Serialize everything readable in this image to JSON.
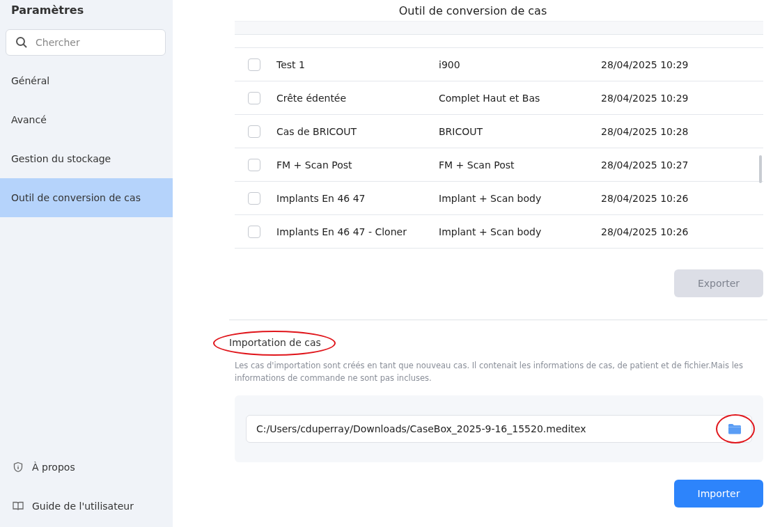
{
  "sidebar": {
    "title": "Paramètres",
    "search": {
      "placeholder": "Chercher"
    },
    "items": [
      {
        "label": "Général",
        "selected": false
      },
      {
        "label": "Avancé",
        "selected": false
      },
      {
        "label": "Gestion du stockage",
        "selected": false
      },
      {
        "label": "Outil de conversion de cas",
        "selected": true
      }
    ],
    "footer": [
      {
        "label": "À propos",
        "kind": "about"
      },
      {
        "label": "Guide de l'utilisateur",
        "kind": "guide"
      }
    ]
  },
  "title": "Outil de conversion de cas",
  "table": {
    "rows": [
      {
        "case": "Test 1",
        "patient": "i900",
        "date": "28/04/2025 10:29",
        "checked": false
      },
      {
        "case": "Crête édentée",
        "patient": "Complet Haut et Bas",
        "date": "28/04/2025 10:29",
        "checked": false
      },
      {
        "case": "Cas de BRICOUT",
        "patient": "BRICOUT",
        "date": "28/04/2025 10:28",
        "checked": false
      },
      {
        "case": "FM + Scan Post",
        "patient": "FM + Scan Post",
        "date": "28/04/2025 10:27",
        "checked": false
      },
      {
        "case": "Implants En 46 47",
        "patient": "Implant + Scan body",
        "date": "28/04/2025 10:26",
        "checked": false
      },
      {
        "case": "Implants En 46 47 - Cloner",
        "patient": "Implant + Scan body",
        "date": "28/04/2025 10:26",
        "checked": false
      }
    ]
  },
  "export_button": {
    "label": "Exporter",
    "disabled": true
  },
  "import": {
    "title": "Importation de cas",
    "title_circled": true,
    "description": "Les cas d'importation sont créés en tant que nouveau cas. Il contenait les informations de cas, de patient et de fichier.Mais les informations de commande ne sont pas incluses.",
    "path": "C:/Users/cduperray/Downloads/CaseBox_2025-9-16_15520.meditex",
    "folder_circled": true,
    "button": {
      "label": "Importer",
      "disabled": false
    }
  }
}
